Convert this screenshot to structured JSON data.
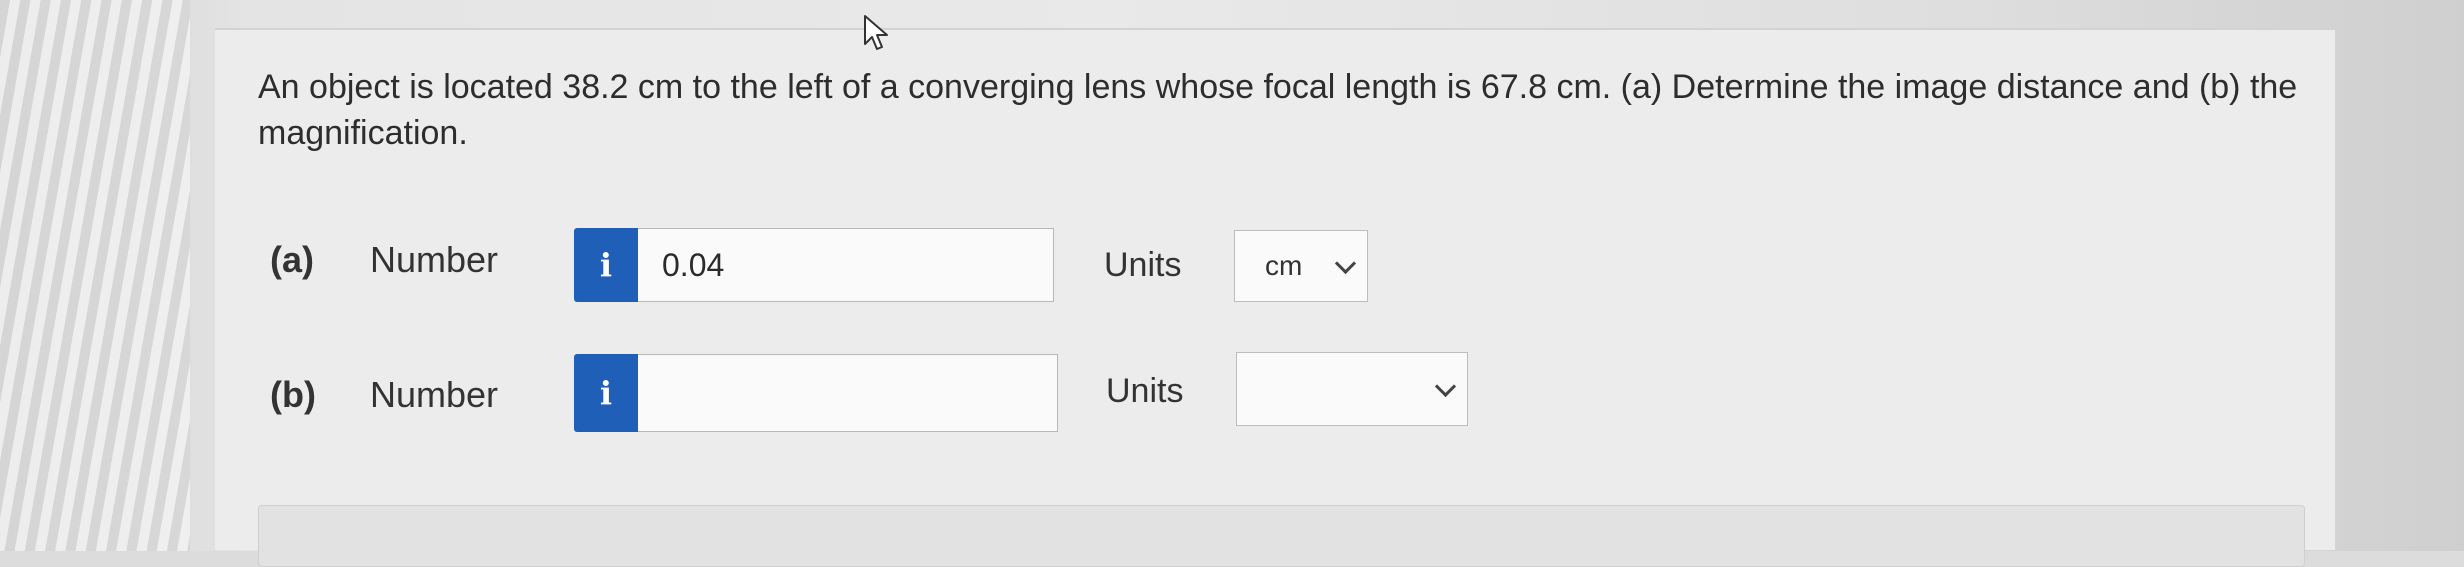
{
  "question": {
    "text": "An object is located 38.2 cm to the left of a converging lens whose focal length is 67.8 cm. (a) Determine the image distance and (b) the magnification."
  },
  "parts": [
    {
      "label": "(a)",
      "number_label": "Number",
      "info_icon": "info-icon",
      "value": "0.04",
      "units_label": "Units",
      "units_value": "cm"
    },
    {
      "label": "(b)",
      "number_label": "Number",
      "info_icon": "info-icon",
      "value": "",
      "units_label": "Units",
      "units_value": ""
    }
  ],
  "colors": {
    "info_button": "#1f5fb8",
    "background": "#e9e9e9"
  }
}
